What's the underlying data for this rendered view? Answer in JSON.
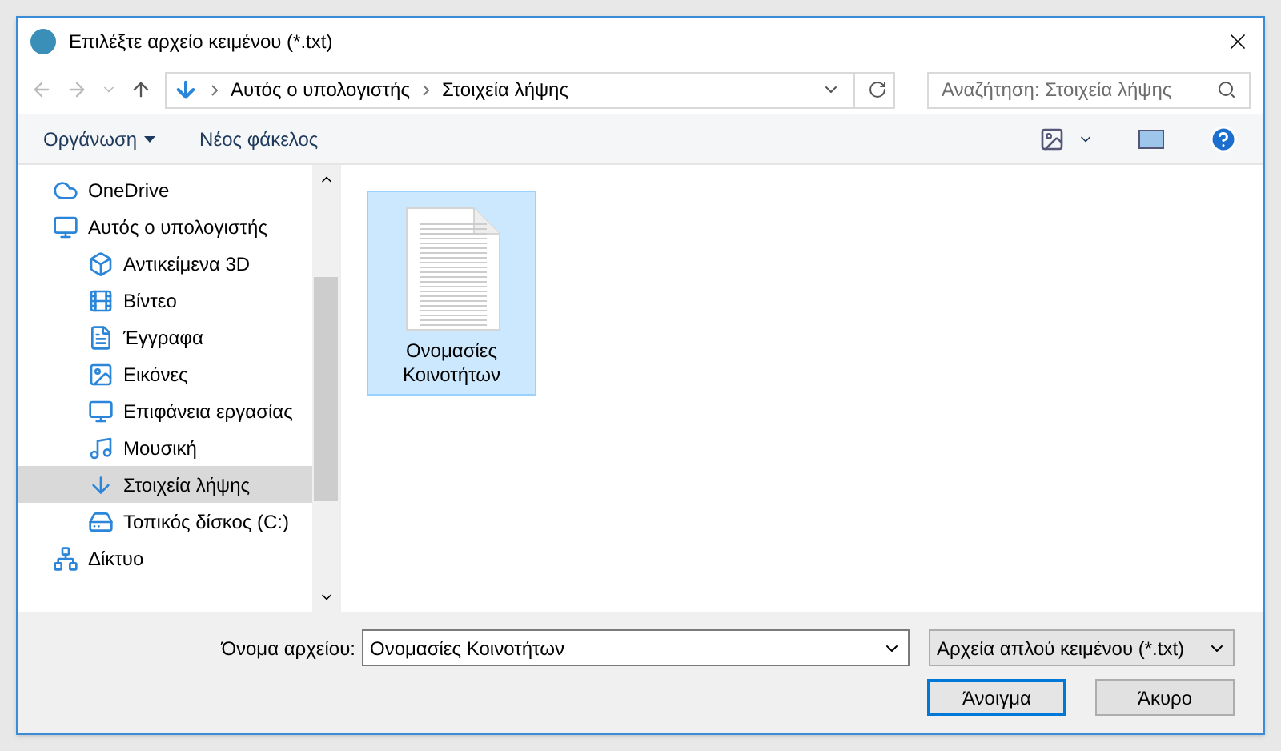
{
  "window": {
    "title": "Επιλέξτε αρχείο κειμένου (*.txt)"
  },
  "address_bar": {
    "path": [
      "Αυτός ο υπολογιστής",
      "Στοιχεία λήψης"
    ]
  },
  "search": {
    "placeholder": "Αναζήτηση: Στοιχεία λήψης"
  },
  "toolbar": {
    "organize": "Οργάνωση",
    "new_folder": "Νέος φάκελος"
  },
  "sidebar": {
    "items": [
      {
        "label": "OneDrive",
        "kind": "cloud",
        "selected": false
      },
      {
        "label": "Αυτός ο υπολογιστής",
        "kind": "computer",
        "selected": false,
        "children": [
          {
            "label": "Αντικείμενα 3D",
            "kind": "cube",
            "selected": false
          },
          {
            "label": "Βίντεο",
            "kind": "film",
            "selected": false
          },
          {
            "label": "Έγγραφα",
            "kind": "document",
            "selected": false
          },
          {
            "label": "Εικόνες",
            "kind": "picture",
            "selected": false
          },
          {
            "label": "Επιφάνεια εργασίας",
            "kind": "desktop",
            "selected": false
          },
          {
            "label": "Μουσική",
            "kind": "music",
            "selected": false
          },
          {
            "label": "Στοιχεία λήψης",
            "kind": "download",
            "selected": true
          },
          {
            "label": "Τοπικός δίσκος (C:)",
            "kind": "drive",
            "selected": false
          }
        ]
      },
      {
        "label": "Δίκτυο",
        "kind": "network",
        "selected": false
      }
    ]
  },
  "files": [
    {
      "name": "Ονομασίες Κοινοτήτων",
      "selected": true
    }
  ],
  "footer": {
    "filename_label": "Όνομα αρχείου:",
    "filename_value": "Ονομασίες Κοινοτήτων",
    "filter": "Αρχεία απλού κειμένου (*.txt)",
    "open": "Άνοιγμα",
    "cancel": "Άκυρο"
  }
}
